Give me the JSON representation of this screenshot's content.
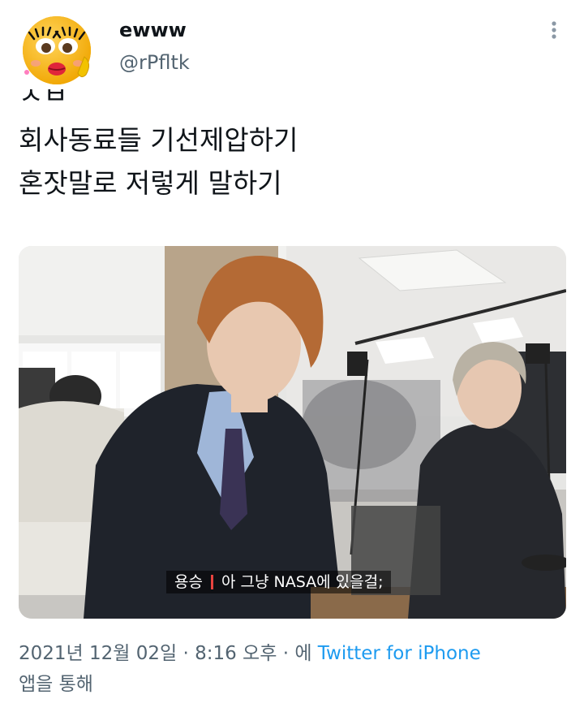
{
  "author": {
    "display_name": "ewww",
    "handle": "@rPfltk"
  },
  "tweet": {
    "lines": [
      "ㅅㅂ",
      "회사동료들 기선제압하기",
      "혼잣말로 저렇게 말하기"
    ]
  },
  "media": {
    "subtitle_speaker": "용승",
    "subtitle_text": "아 그냥 NASA에 있을걸;"
  },
  "meta": {
    "timestamp": "2021년 12월 02일 · 8:16 오후 · 에",
    "source": "Twitter for iPhone",
    "suffix": "앱을 통해"
  },
  "colors": {
    "text": "#0f1419",
    "secondary": "#536471",
    "link": "#1d9bf0",
    "subtitle_accent": "#e8433f"
  },
  "icons": {
    "avatar": "emoji-face-avatar",
    "more": "vertical-ellipsis-icon"
  }
}
